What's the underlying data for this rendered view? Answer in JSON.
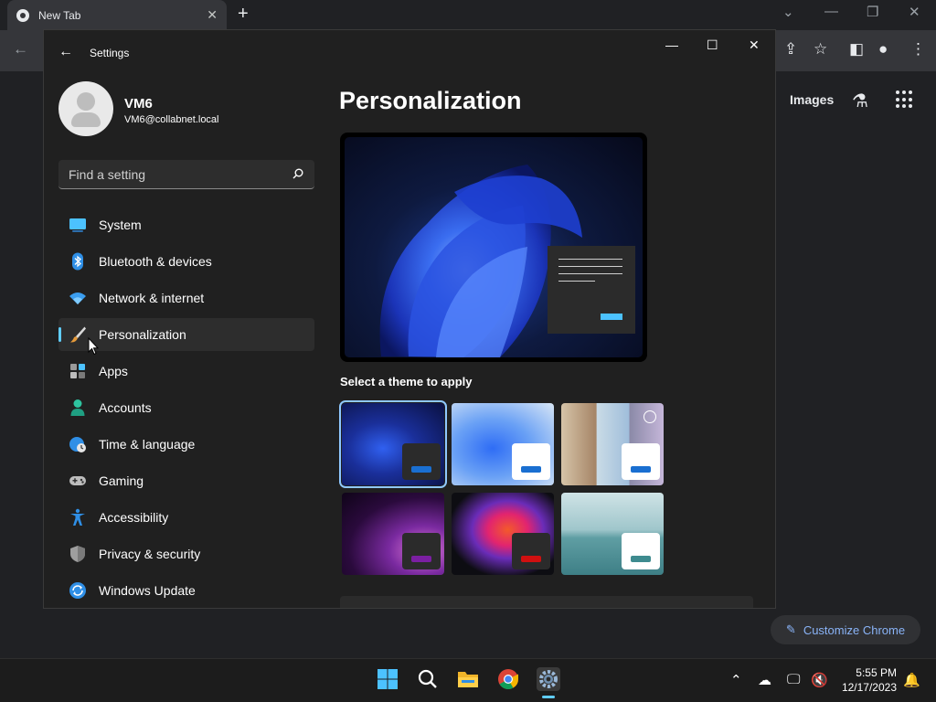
{
  "chrome": {
    "tab_title": "New Tab",
    "images_link": "Images",
    "customize_label": "Customize Chrome",
    "colors": {
      "background": "#202124",
      "toolbar": "#35363a",
      "link_blue": "#8ab4f8"
    }
  },
  "settings": {
    "window_title": "Settings",
    "profile": {
      "name": "VM6",
      "email": "VM6@collabnet.local"
    },
    "search": {
      "placeholder": "Find a setting"
    },
    "nav": [
      {
        "label": "System",
        "icon": "monitor-icon"
      },
      {
        "label": "Bluetooth & devices",
        "icon": "bluetooth-icon"
      },
      {
        "label": "Network & internet",
        "icon": "wifi-icon"
      },
      {
        "label": "Personalization",
        "icon": "paintbrush-icon",
        "active": true
      },
      {
        "label": "Apps",
        "icon": "apps-icon"
      },
      {
        "label": "Accounts",
        "icon": "person-icon"
      },
      {
        "label": "Time & language",
        "icon": "globe-clock-icon"
      },
      {
        "label": "Gaming",
        "icon": "gamepad-icon"
      },
      {
        "label": "Accessibility",
        "icon": "accessibility-icon"
      },
      {
        "label": "Privacy & security",
        "icon": "shield-icon"
      },
      {
        "label": "Windows Update",
        "icon": "update-icon"
      }
    ],
    "page_title": "Personalization",
    "themes_label": "Select a theme to apply",
    "themes": [
      {
        "name": "dark-bloom",
        "selected": true,
        "accent": "#1a6fd1"
      },
      {
        "name": "light-bloom",
        "selected": false,
        "accent": "#1a6fd1"
      },
      {
        "name": "spotlight",
        "selected": false,
        "accent": "#1a6fd1"
      },
      {
        "name": "glow",
        "selected": false,
        "accent": "#7b1fa2"
      },
      {
        "name": "captured-motion",
        "selected": false,
        "accent": "#d01010"
      },
      {
        "name": "flow",
        "selected": false,
        "accent": "#3e8b8f"
      }
    ],
    "colors": {
      "window_bg": "#202020",
      "accent": "#60cdff",
      "nav_active_bg": "#2d2d2d"
    }
  },
  "taskbar": {
    "apps": [
      "start-icon",
      "search-icon",
      "file-explorer-icon",
      "chrome-icon",
      "settings-icon"
    ],
    "active_app": "settings-icon",
    "time": "5:55 PM",
    "date": "12/17/2023"
  }
}
